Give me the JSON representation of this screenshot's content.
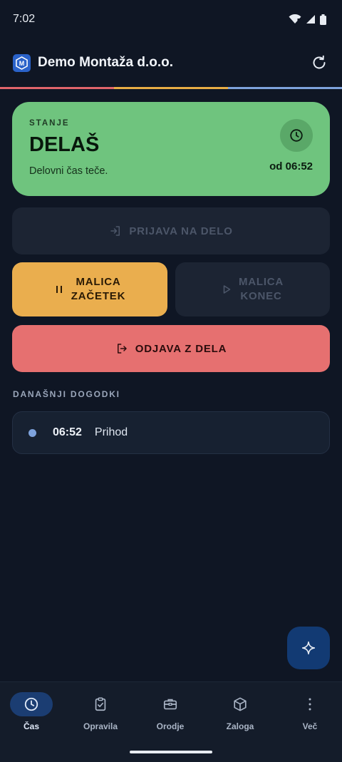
{
  "status_bar": {
    "time": "7:02"
  },
  "app_bar": {
    "title": "Demo Montaža d.o.o.",
    "logo_letter": "M"
  },
  "accent_colors": [
    "#e0646b",
    "#e8ad45",
    "#7ea3dd"
  ],
  "status_card": {
    "label": "STANJE",
    "value": "DELAŠ",
    "subtitle": "Delovni čas teče.",
    "since": "od 06:52",
    "color": "#6fc47e"
  },
  "actions": {
    "login": "PRIJAVA NA DELO",
    "lunch_start_line1": "MALICA",
    "lunch_start_line2": "ZAČETEK",
    "lunch_end_line1": "MALICA",
    "lunch_end_line2": "KONEC",
    "logout": "ODJAVA Z DELA"
  },
  "events": {
    "title": "DANAŠNJI DOGODKI",
    "items": [
      {
        "time": "06:52",
        "label": "Prihod"
      }
    ]
  },
  "bottom_nav": {
    "items": [
      {
        "label": "Čas",
        "icon": "clock-icon",
        "active": true
      },
      {
        "label": "Opravila",
        "icon": "clipboard-check-icon",
        "active": false
      },
      {
        "label": "Orodje",
        "icon": "toolbox-icon",
        "active": false
      },
      {
        "label": "Zaloga",
        "icon": "box-icon",
        "active": false
      },
      {
        "label": "Več",
        "icon": "more-vertical-icon",
        "active": false
      }
    ]
  }
}
